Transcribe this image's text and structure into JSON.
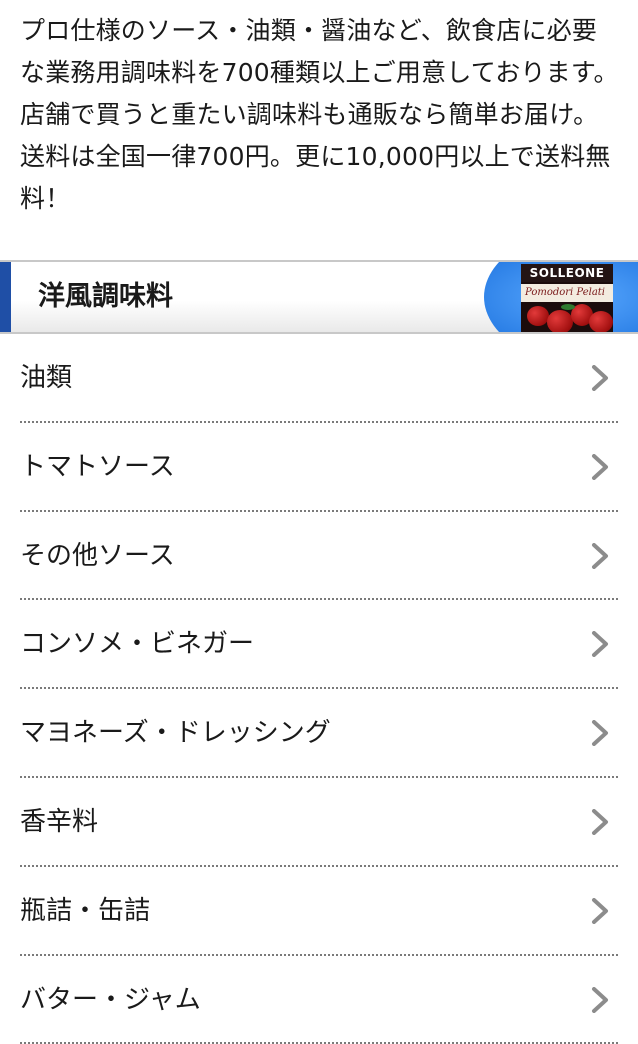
{
  "intro": {
    "text": "プロ仕様のソース・油類・醤油など、飲食店に必要な業務用調味料を700種類以上ご用意しております。 店舗で買うと重たい調味料も通販なら簡単お届け。 送料は全国一律700円。更に10,000円以上で送料無料！"
  },
  "section": {
    "title": "洋風調味料",
    "product_image": {
      "brand_text": "SOLLEONE",
      "label_text": "Pomodori Pelati"
    },
    "accent_color": "#1f4fa6"
  },
  "menu": {
    "items": [
      {
        "label": "油類",
        "icon": "chevron-right-icon"
      },
      {
        "label": "トマトソース",
        "icon": "chevron-right-icon"
      },
      {
        "label": "その他ソース",
        "icon": "chevron-right-icon"
      },
      {
        "label": "コンソメ・ビネガー",
        "icon": "chevron-right-icon"
      },
      {
        "label": "マヨネーズ・ドレッシング",
        "icon": "chevron-right-icon"
      },
      {
        "label": "香辛料",
        "icon": "chevron-right-icon"
      },
      {
        "label": "瓶詰・缶詰",
        "icon": "chevron-right-icon"
      },
      {
        "label": "バター・ジャム",
        "icon": "chevron-right-icon"
      }
    ]
  }
}
